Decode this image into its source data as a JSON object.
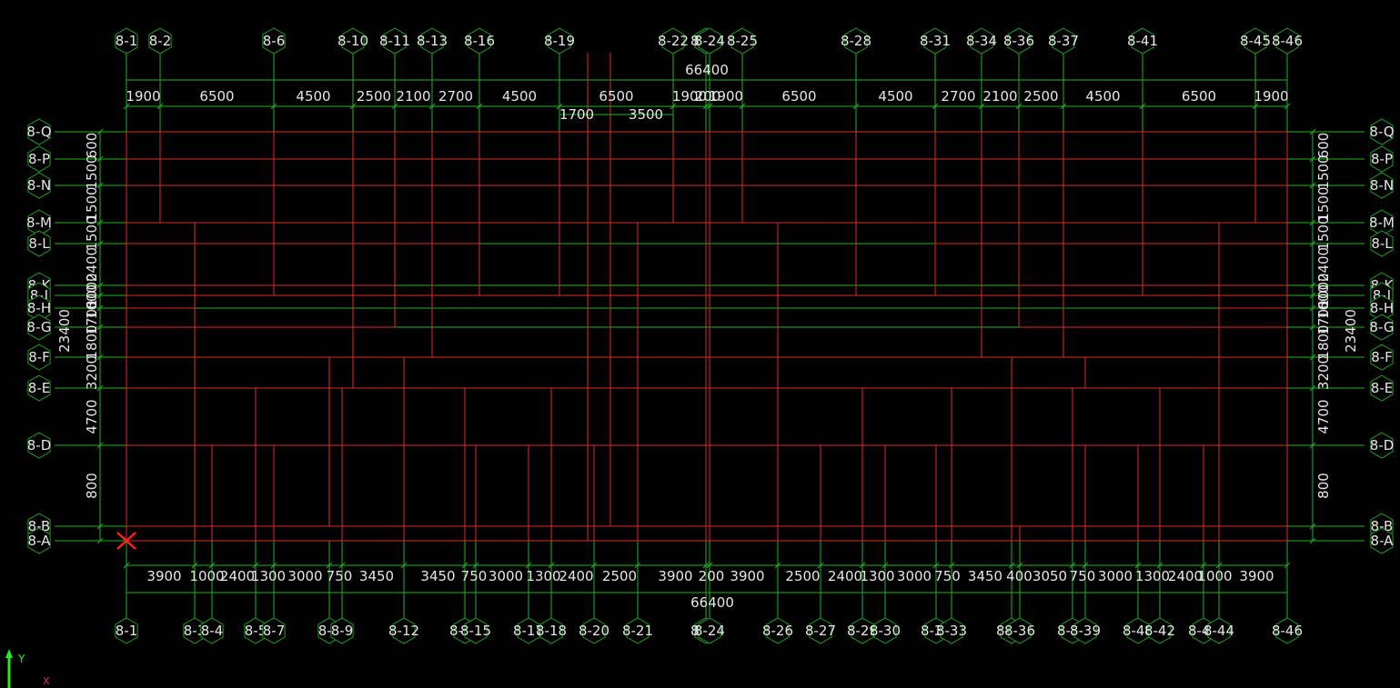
{
  "grid_columns_top": [
    "8-1",
    "8-2",
    "8-6",
    "8-10",
    "8-11",
    "8-13",
    "8-16",
    "8-19",
    "8-22",
    "8-23",
    "8-24",
    "8-25",
    "8-28",
    "8-31",
    "8-34",
    "8-36",
    "8-37",
    "8-41",
    "8-45",
    "8-46"
  ],
  "grid_columns_bottom": [
    "8-1",
    "8-3",
    "8-4",
    "8-5",
    "8-7",
    "8-8",
    "8-9",
    "8-12",
    "8-14",
    "8-15",
    "8-17",
    "8-18",
    "8-20",
    "8-21",
    "8-22",
    "8-24",
    "8-26",
    "8-27",
    "8-29",
    "8-30",
    "8-32",
    "8-33",
    "8-35",
    "8-36",
    "8-38",
    "8-39",
    "8-40",
    "8-42",
    "8-43",
    "8-44",
    "8-46"
  ],
  "grid_rows": [
    "8-Q",
    "8-P",
    "8-N",
    "8-M",
    "8-L",
    "8-K",
    "8-J",
    "8-H",
    "8-G",
    "8-F",
    "8-E",
    "8-D",
    "8-B",
    "8-A"
  ],
  "dimensions": {
    "top_overall": "66400",
    "top_spans": [
      "1900",
      "6500",
      "4500",
      "2500",
      "2100",
      "2700",
      "4500",
      "6500",
      "1900",
      "200",
      "1900",
      "6500",
      "4500",
      "2700",
      "2100",
      "2500",
      "4500",
      "6500",
      "1900"
    ],
    "top_sub_spans": [
      "1700",
      "3500"
    ],
    "bottom_spans": [
      "3900",
      "1000",
      "2400",
      "1300",
      "3000",
      "750",
      "3450",
      "3450",
      "750",
      "3000",
      "1300",
      "2400",
      "2500",
      "3900",
      "200",
      "3900",
      "2500",
      "2400",
      "1300",
      "3000",
      "750",
      "3450",
      "400",
      "3050",
      "750",
      "3000",
      "1300",
      "2400",
      "1000",
      "3900"
    ],
    "bottom_overall": "66400",
    "side_overall": "23400",
    "side_spans": [
      "600",
      "1500",
      "1500",
      "1500",
      "2400",
      "1000",
      "1600",
      "1700",
      "1800",
      "3200",
      "4700",
      "800"
    ]
  },
  "axis_indicator": {
    "y_label": "Y",
    "x_label": "X"
  },
  "colors": {
    "background": "#000000",
    "beams": "#dd2c2c",
    "grid": "#22b022",
    "text": "#e6e6e6",
    "origin_marker": "#ff2020",
    "axis_y": "#22ee22"
  }
}
